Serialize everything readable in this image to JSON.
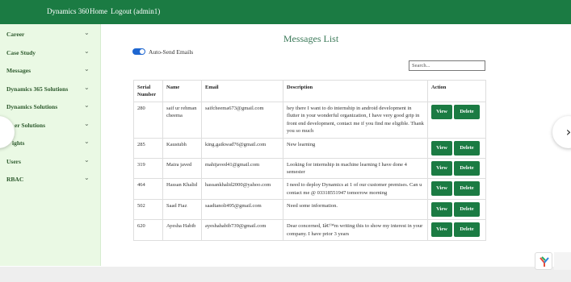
{
  "header": {
    "brand": "Dynamics 360",
    "nav": [
      "Home",
      "Logout (admin1)"
    ]
  },
  "sidebar": {
    "items": [
      {
        "label": "Career"
      },
      {
        "label": "Case Study"
      },
      {
        "label": "Messages"
      },
      {
        "label": "Dynamics 365 Solutions"
      },
      {
        "label": "Dynamics Solutions"
      },
      {
        "label": "er Solutions"
      },
      {
        "label": "ights"
      },
      {
        "label": "Users"
      },
      {
        "label": "RBAC"
      }
    ],
    "chevron_icon": "chevron-down-icon"
  },
  "main": {
    "title": "Messages List",
    "toggle": {
      "label": "Auto-Send Emails",
      "on": true,
      "color": "#1e66d0"
    },
    "search_placeholder": "Search...",
    "table": {
      "headers": [
        "Serial Number",
        "Name",
        "Email",
        "Description",
        "Action"
      ],
      "rows": [
        {
          "serial": "280",
          "name": "saif ur rehman cheema",
          "email": "saifcheema673@gmail.com",
          "description": "hey there I want to do internship in android development in flutter in your wonderful organization, I have very good grip in front end development, contact me if you find me eligible. Thank you so much"
        },
        {
          "serial": "285",
          "name": "Kaustubh",
          "email": "king.gaikwad76@gmail.com",
          "description": "New learning"
        },
        {
          "serial": "319",
          "name": "Maira javed",
          "email": "mahijaved41@gmail.com",
          "description": "Looking for internship in machine learning I have done 4 semester"
        },
        {
          "serial": "464",
          "name": "Hassan Khalid",
          "email": "hassankhalid2000@yahoo.com",
          "description": "I need to deploy Dynamics at 1 of our customer premises. Can u contact me @ 03318551947 tomorrow morning"
        },
        {
          "serial": "502",
          "name": "Saad Fiaz",
          "email": "saadtanoli495@gmail.com",
          "description": "Need some information."
        },
        {
          "serial": "620",
          "name": "Ayesha Habib",
          "email": "ayeshahabib739@gmail.com",
          "description": "Dear concerned, Iâ€™m writing this to show my interest in your company. I have prior 3 years"
        }
      ],
      "view_label": "View",
      "delete_label": "Delete"
    }
  },
  "carousel": {
    "prev": "‹",
    "next": "›"
  },
  "colors": {
    "header": "#1b7b43",
    "sidebar": "#eaf9e4",
    "button": "#1b7b43",
    "title": "#3d7a5a"
  }
}
